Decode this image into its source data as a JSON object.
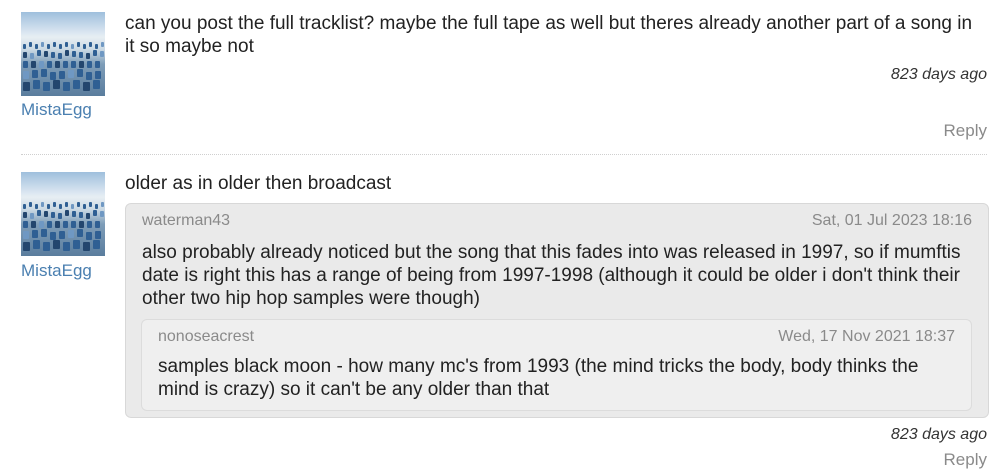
{
  "comments": [
    {
      "username": "MistaEgg",
      "text": "can you post the full tracklist? maybe the full tape as well but theres already another part of a song in it so maybe not",
      "age": "823 days ago",
      "reply_label": "Reply"
    },
    {
      "username": "MistaEgg",
      "text": "older as in older then broadcast",
      "quote": {
        "author": "waterman43",
        "date": "Sat, 01 Jul 2023 18:16",
        "text": "also probably already noticed but the song that this fades into was released in 1997, so if mumftis date is right this has a range of being from 1997-1998 (although it could be older i don't think their other two hip hop samples were though)",
        "quote": {
          "author": "nonoseacrest",
          "date": "Wed, 17 Nov 2021 18:37",
          "text": "samples black moon - how many mc's from 1993 (the mind tricks the body, body thinks the mind is crazy) so it can't be any older than that"
        }
      },
      "age": "823 days ago",
      "reply_label": "Reply"
    }
  ]
}
